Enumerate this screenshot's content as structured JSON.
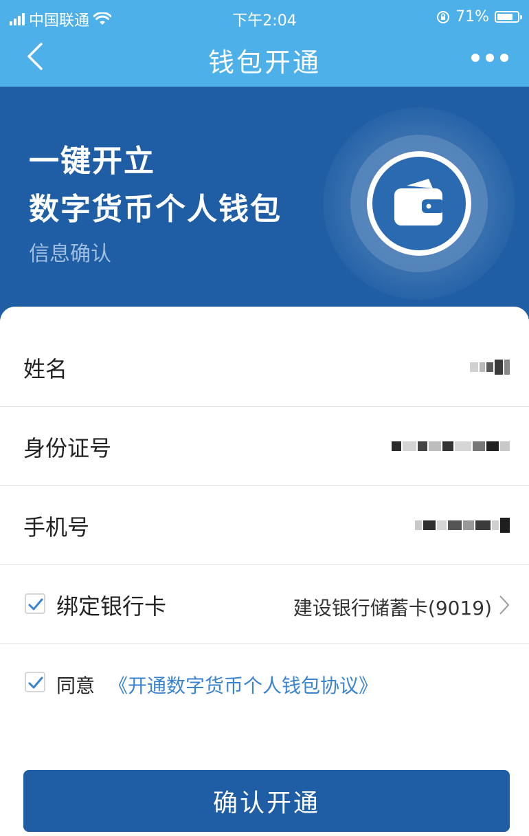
{
  "status_bar": {
    "carrier": "中国联通",
    "time": "下午2:04",
    "battery": "71%",
    "battery_level": 0.71
  },
  "nav": {
    "title": "钱包开通",
    "back_icon": "chevron-left-icon",
    "more_icon": "more-dots-icon"
  },
  "hero": {
    "line1": "一键开立",
    "line2": "数字货币个人钱包",
    "subtitle": "信息确认",
    "icon": "wallet-icon"
  },
  "form": {
    "name_label": "姓名",
    "id_label": "身份证号",
    "phone_label": "手机号",
    "bind_card_label": "绑定银行卡",
    "bind_card_checked": true,
    "bank_card_value": "建设银行储蓄卡(9019)"
  },
  "agreement": {
    "checked": true,
    "agree_label": "同意",
    "link_text": "《开通数字货币个人钱包协议》"
  },
  "confirm_button": "确认开通",
  "colors": {
    "nav_bg": "#4eb0e9",
    "hero_bg": "#1f5ea5",
    "link": "#3a84cf",
    "check": "#3a84cf",
    "button_bg": "#1f5ea5"
  }
}
